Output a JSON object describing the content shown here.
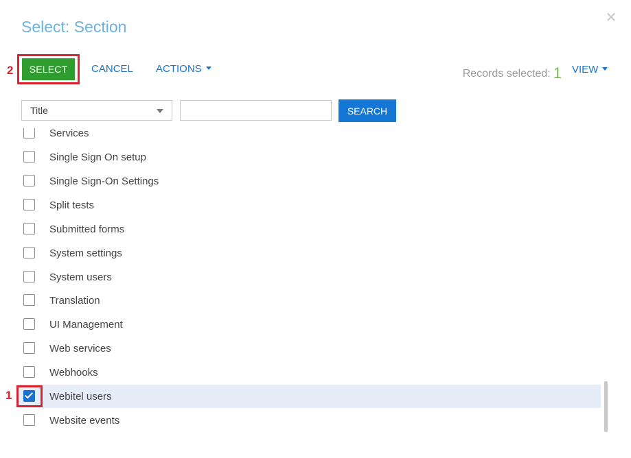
{
  "dialog": {
    "title": "Select: Section",
    "close_icon": "close-icon"
  },
  "toolbar": {
    "select_label": "SELECT",
    "cancel_label": "CANCEL",
    "actions_label": "ACTIONS",
    "records_selected_label": "Records selected:",
    "records_selected_count": "1",
    "view_label": "VIEW"
  },
  "markers": {
    "step1": "1",
    "step2": "2"
  },
  "filter": {
    "column_value": "Title",
    "search_value": "",
    "search_placeholder": "",
    "search_label": "SEARCH"
  },
  "list": {
    "items": [
      {
        "label": "Services",
        "checked": false
      },
      {
        "label": "Single Sign On setup",
        "checked": false
      },
      {
        "label": "Single Sign-On Settings",
        "checked": false
      },
      {
        "label": "Split tests",
        "checked": false
      },
      {
        "label": "Submitted forms",
        "checked": false
      },
      {
        "label": "System settings",
        "checked": false
      },
      {
        "label": "System users",
        "checked": false
      },
      {
        "label": "Translation",
        "checked": false
      },
      {
        "label": "UI Management",
        "checked": false
      },
      {
        "label": "Web services",
        "checked": false
      },
      {
        "label": "Webhooks",
        "checked": false
      },
      {
        "label": "Webitel users",
        "checked": true
      },
      {
        "label": "Website events",
        "checked": false
      }
    ]
  },
  "colors": {
    "title": "#6cb3e0",
    "select_button": "#2f9c2f",
    "search_button": "#1477d6",
    "link": "#1a73c8",
    "count": "#6fc04a",
    "highlight": "#d9232e",
    "selected_row": "#e7edf8"
  }
}
